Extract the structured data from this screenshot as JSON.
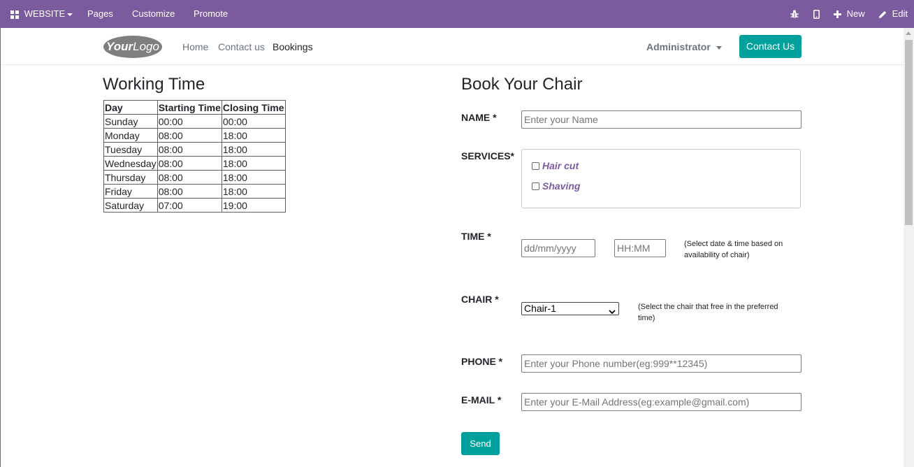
{
  "topbar": {
    "website_label": "WEBSITE",
    "pages_label": "Pages",
    "customize_label": "Customize",
    "promote_label": "Promote",
    "new_label": "New",
    "edit_label": "Edit"
  },
  "navbar": {
    "logo_text": "YourLogo",
    "links": [
      "Home",
      "Contact us",
      "Bookings"
    ],
    "active_link": "Bookings",
    "user": "Administrator",
    "contact_button": "Contact Us"
  },
  "working_time": {
    "title": "Working Time",
    "headers": [
      "Day",
      "Starting Time",
      "Closing Time"
    ],
    "rows": [
      [
        "Sunday",
        "00:00",
        "00:00"
      ],
      [
        "Monday",
        "08:00",
        "18:00"
      ],
      [
        "Tuesday",
        "08:00",
        "18:00"
      ],
      [
        "Wednesday",
        "08:00",
        "18:00"
      ],
      [
        "Thursday",
        "08:00",
        "18:00"
      ],
      [
        "Friday",
        "08:00",
        "18:00"
      ],
      [
        "Saturday",
        "07:00",
        "19:00"
      ]
    ]
  },
  "booking": {
    "title": "Book Your Chair",
    "name_label": "NAME *",
    "name_placeholder": "Enter your Name",
    "services_label": "SERVICES*",
    "services": [
      "Hair cut",
      "Shaving"
    ],
    "time_label": "TIME *",
    "date_placeholder": "dd/mm/yyyy",
    "time_placeholder": "HH:MM",
    "time_hint": "(Select date & time based on availability of chair)",
    "chair_label": "CHAIR *",
    "chair_selected": "Chair-1",
    "chair_hint": "(Select the chair that free in the preferred time)",
    "phone_label": "PHONE *",
    "phone_placeholder": "Enter your Phone number(eg:999**12345)",
    "email_label": "E-MAIL *",
    "email_placeholder": "Enter your E-Mail Address(eg:example@gmail.com)",
    "send_button": "Send"
  },
  "colors": {
    "topbar": "#7c5a9e",
    "accent": "#00a09d",
    "service_text": "#7c5a9e"
  }
}
